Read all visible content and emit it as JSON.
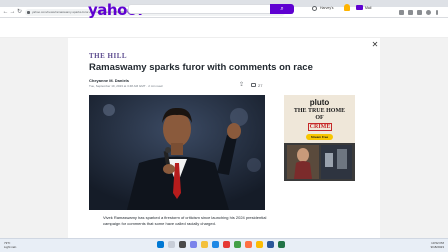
{
  "browser": {
    "url": "yahoo.com/news/ramaswamy-sparks-furor-comments-race-172600674.html"
  },
  "header": {
    "logo": "yahoo!",
    "search_placeholder": "",
    "search_button": "⌕",
    "user_label": "Harvey's",
    "mail_label": "Mail"
  },
  "article": {
    "publisher": "THE HILL",
    "headline": "Ramaswamy sparks furor with comments on race",
    "author": "Cheyanne M. Daniels",
    "dateline": "Tue, September 19, 2023 at 3:48 AM GMT · 2 min read",
    "comment_count": "27",
    "close_label": "✕",
    "body": "Vivek Ramaswamy has sparked a firestorm of criticism since launching his 2024 presidential campaign for comments that some have called racially charged."
  },
  "ad": {
    "logo": "pluto",
    "line1": "THE TRUE HOME",
    "line2": "OF",
    "line3": "CRIME",
    "button": "Stream Free"
  },
  "taskbar": {
    "weather_temp": "73°F",
    "weather_text": "Light rain",
    "time": "10:52 PM",
    "date": "9/18/2023"
  },
  "colors": {
    "yahoo_purple": "#5f01d1",
    "publisher_purple": "#5b4a8e",
    "crime_red": "#c62828"
  }
}
